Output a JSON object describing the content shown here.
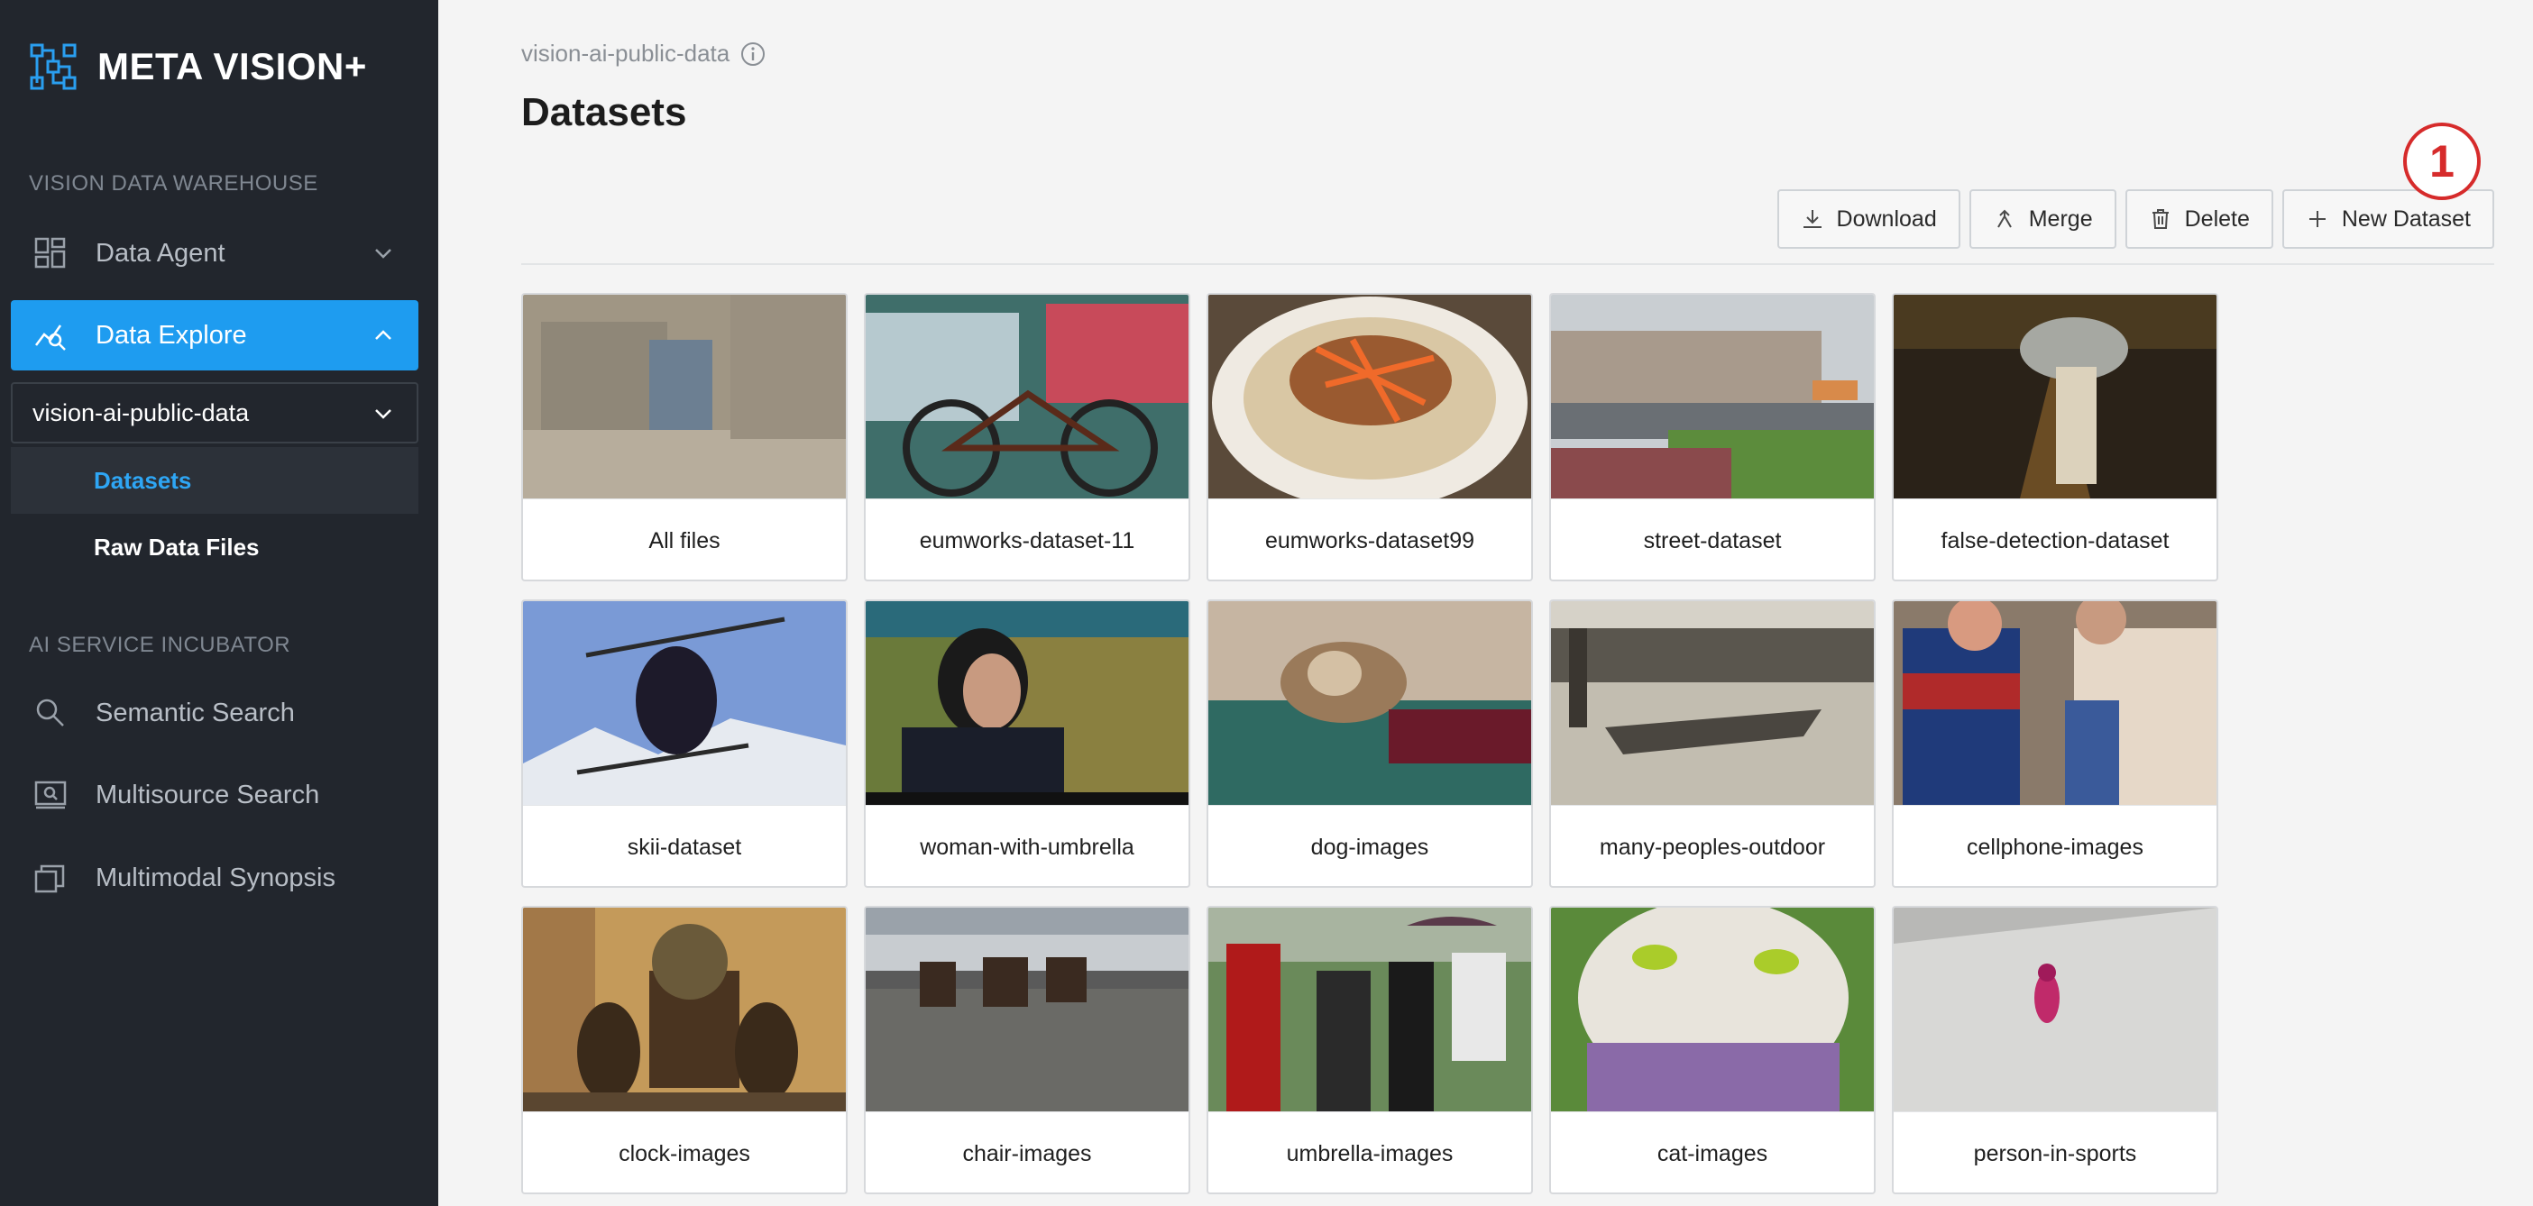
{
  "app": {
    "name": "META VISION+"
  },
  "sidebar": {
    "section1": "VISION DATA WAREHOUSE",
    "data_agent": "Data Agent",
    "data_explore": "Data Explore",
    "workspace": "vision-ai-public-data",
    "datasets": "Datasets",
    "raw_files": "Raw Data Files",
    "section2": "AI SERVICE INCUBATOR",
    "semantic_search": "Semantic Search",
    "multisource_search": "Multisource Search",
    "multimodal_synopsis": "Multimodal Synopsis"
  },
  "header": {
    "breadcrumb": "vision-ai-public-data",
    "title": "Datasets"
  },
  "toolbar": {
    "download": "Download",
    "merge": "Merge",
    "delete": "Delete",
    "new_dataset": "New Dataset"
  },
  "annotation": {
    "marker": "1"
  },
  "datasets": [
    {
      "label": "All files"
    },
    {
      "label": "eumworks-dataset-11"
    },
    {
      "label": "eumworks-dataset99"
    },
    {
      "label": "street-dataset"
    },
    {
      "label": "false-detection-dataset"
    },
    {
      "label": "skii-dataset"
    },
    {
      "label": "woman-with-umbrella"
    },
    {
      "label": "dog-images"
    },
    {
      "label": "many-peoples-outdoor"
    },
    {
      "label": "cellphone-images"
    },
    {
      "label": "clock-images"
    },
    {
      "label": "chair-images"
    },
    {
      "label": "umbrella-images"
    },
    {
      "label": "cat-images"
    },
    {
      "label": "person-in-sports"
    }
  ]
}
